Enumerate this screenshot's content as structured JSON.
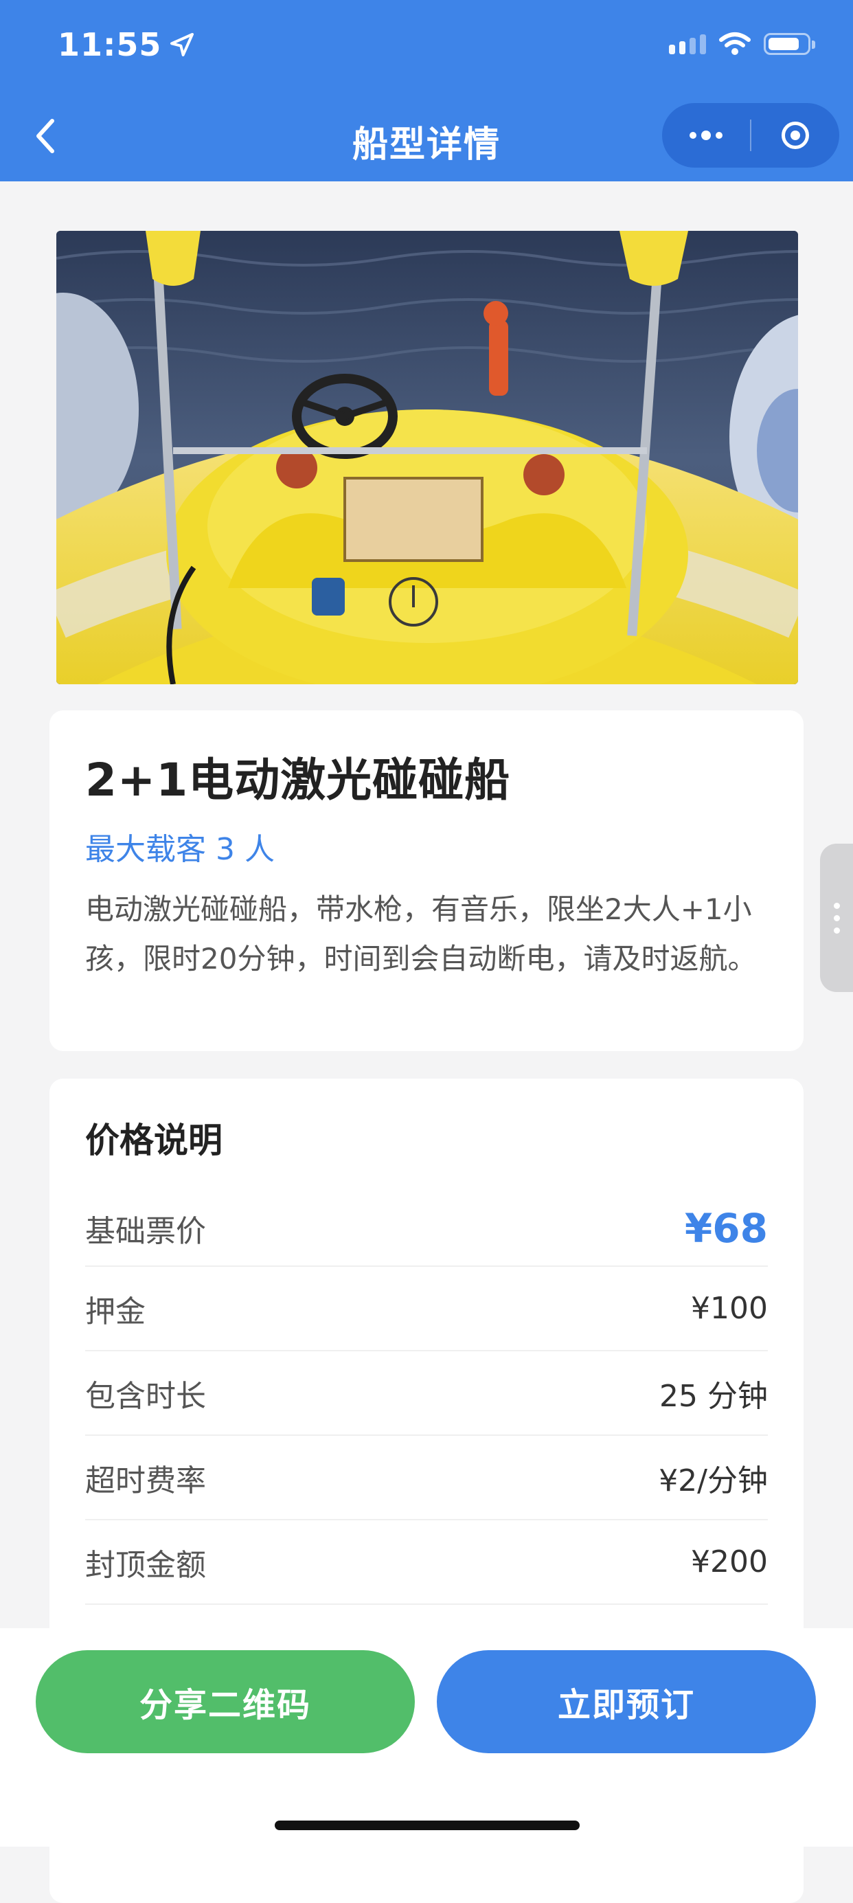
{
  "status_bar": {
    "time": "11:55"
  },
  "nav": {
    "title": "船型详情"
  },
  "boat": {
    "name": "2+1电动激光碰碰船",
    "capacity": "最大载客 3 人",
    "description": "电动激光碰碰船，带水枪，有音乐，限坐2大人+1小孩，限时20分钟，时间到会自动断电，请及时返航。"
  },
  "price": {
    "title": "价格说明",
    "rows": [
      {
        "label": "基础票价",
        "value": "¥68"
      },
      {
        "label": "押金",
        "value": "¥100"
      },
      {
        "label": "包含时长",
        "value": "25 分钟"
      },
      {
        "label": "超时费率",
        "value": "¥2/分钟"
      },
      {
        "label": "封顶金额",
        "value": "¥200"
      }
    ]
  },
  "actions": {
    "share": "分享二维码",
    "book": "立即预订"
  },
  "colors": {
    "brand": "#3e84e8",
    "share": "#52be6a"
  }
}
